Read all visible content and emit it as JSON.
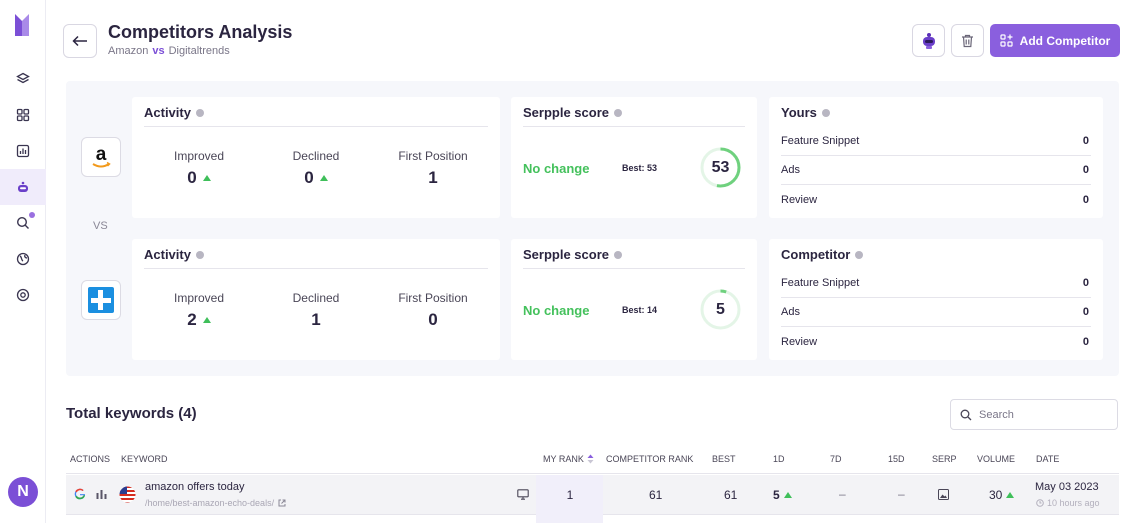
{
  "header": {
    "title": "Competitors Analysis",
    "site_a": "Amazon",
    "vs": "vs",
    "site_b": "Digitaltrends",
    "add_button": "Add Competitor"
  },
  "comparison": {
    "vs_label": "VS",
    "rows": [
      {
        "logo": "amazon-logo",
        "activity_title": "Activity",
        "improved_label": "Improved",
        "improved": "0",
        "declined_label": "Declined",
        "declined": "0",
        "first_label": "First Position",
        "first": "1",
        "score_title": "Serpple score",
        "change": "No change",
        "best": "Best: 53",
        "score": "53",
        "score_value": 53,
        "side_title": "Yours",
        "side": [
          {
            "label": "Feature Snippet",
            "value": "0"
          },
          {
            "label": "Ads",
            "value": "0"
          },
          {
            "label": "Review",
            "value": "0"
          }
        ]
      },
      {
        "logo": "digitaltrends-logo",
        "activity_title": "Activity",
        "improved_label": "Improved",
        "improved": "2",
        "declined_label": "Declined",
        "declined": "1",
        "first_label": "First Position",
        "first": "0",
        "score_title": "Serpple score",
        "change": "No change",
        "best": "Best: 14",
        "score": "5",
        "score_value": 5,
        "side_title": "Competitor",
        "side": [
          {
            "label": "Feature Snippet",
            "value": "0"
          },
          {
            "label": "Ads",
            "value": "0"
          },
          {
            "label": "Review",
            "value": "0"
          }
        ]
      }
    ]
  },
  "keywords": {
    "title": "Total keywords (4)",
    "search_placeholder": "Search",
    "columns": [
      "ACTIONS",
      "KEYWORD",
      "MY RANK",
      "COMPETITOR RANK",
      "BEST",
      "1D",
      "7D",
      "15D",
      "SERP",
      "VOLUME",
      "DATE"
    ],
    "rows": [
      {
        "keyword": "amazon offers today",
        "url": "/home/best-amazon-echo-deals/",
        "my_rank": "1",
        "competitor_rank": "61",
        "best": "61",
        "d1": "5",
        "d7": "–",
        "d15": "–",
        "volume": "30",
        "date": "May 03 2023",
        "ago": "10 hours ago"
      }
    ]
  },
  "user": {
    "initial": "N"
  },
  "colors": {
    "accent": "#8a5fde",
    "positive": "#44c15c",
    "ring": "#6fd17e"
  }
}
